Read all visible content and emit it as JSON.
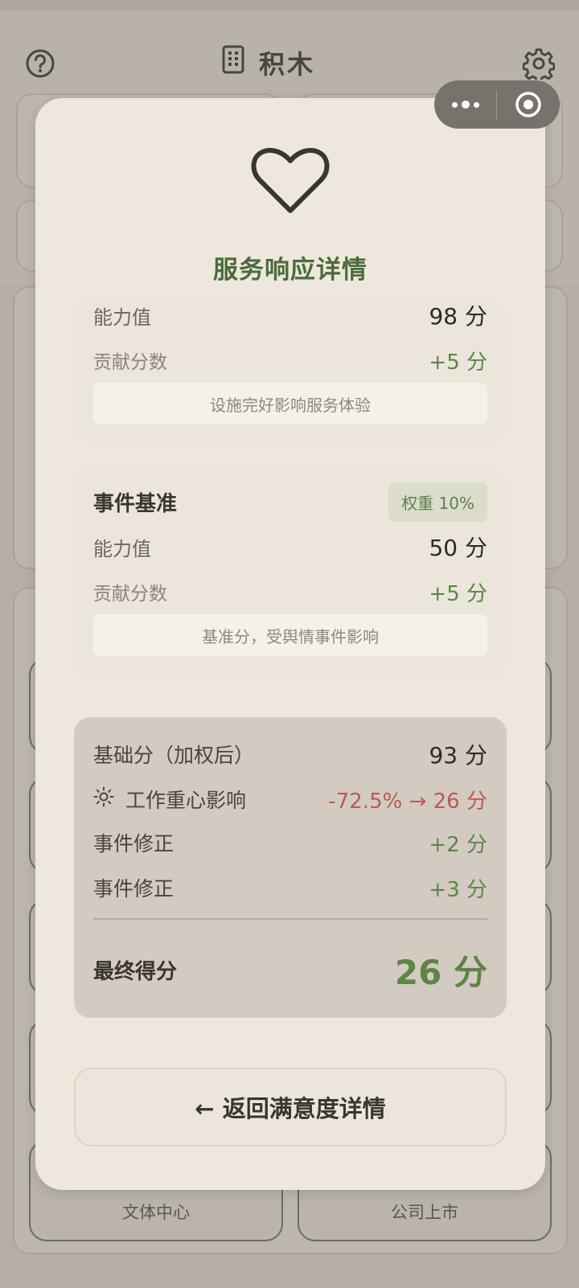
{
  "app": {
    "title": "积木"
  },
  "background": {
    "tiles": [
      {
        "label": "文体中心"
      },
      {
        "label": "公司上市"
      }
    ]
  },
  "modal": {
    "title": "服务响应详情",
    "section1": {
      "ability_label": "能力值",
      "ability_value": "98 分",
      "contribution_label": "贡献分数",
      "contribution_value": "+5 分",
      "note": "设施完好影响服务体验"
    },
    "section2": {
      "title": "事件基准",
      "weight": "权重 10%",
      "ability_label": "能力值",
      "ability_value": "50 分",
      "contribution_label": "贡献分数",
      "contribution_value": "+5 分",
      "note": "基准分，受舆情事件影响"
    },
    "calculation": {
      "base_label": "基础分（加权后）",
      "base_value": "93 分",
      "focus_label": "工作重心影响",
      "focus_value": "-72.5% → 26 分",
      "event1_label": "事件修正",
      "event1_value": "+2 分",
      "event2_label": "事件修正",
      "event2_value": "+3 分",
      "final_label": "最终得分",
      "final_value": "26 分"
    },
    "back_button": "← 返回满意度详情"
  },
  "colors": {
    "accent_green": "#5b8747",
    "title_green": "#4c6b3b",
    "negative_red": "#b65b56",
    "modal_bg": "#ede7dd"
  },
  "icons": [
    "help-icon",
    "building-icon",
    "gear-icon",
    "more-dots-icon",
    "record-icon",
    "heart-icon",
    "sun-icon"
  ]
}
